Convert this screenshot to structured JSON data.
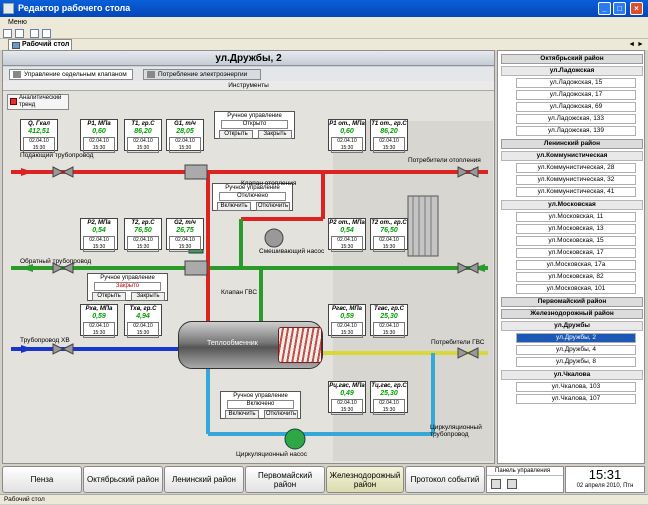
{
  "window": {
    "title": "Редактор рабочего стола",
    "min": "_",
    "max": "□",
    "close": "×"
  },
  "menu": {
    "item": "Меню"
  },
  "tabs": {
    "main": "Рабочий стол",
    "nav": "◄ ►"
  },
  "address": "ул.Дружбы, 2",
  "subtabs": [
    "Управление седельным клапаном",
    "Потребление электроэнергии"
  ],
  "instruments": "Инструменты",
  "trend": "Аналитический тренд",
  "gauges": [
    {
      "label": "Q, Гкал",
      "value": "412,51",
      "date": "02.04.10 15:30"
    },
    {
      "label": "P1, МПа",
      "value": "0,60",
      "date": "02.04.10 15:30"
    },
    {
      "label": "T1, гр.С",
      "value": "86,20",
      "date": "02.04.10 15:30"
    },
    {
      "label": "G1, т/ч",
      "value": "28,05",
      "date": "02.04.10 15:30"
    },
    {
      "label": "P1 от., МПа",
      "value": "0,60",
      "date": "02.04.10 15:30"
    },
    {
      "label": "T1 от., гр.С",
      "value": "86,20",
      "date": "02.04.10 15:30"
    },
    {
      "label": "P2, МПа",
      "value": "0,54",
      "date": "02.04.10 15:30"
    },
    {
      "label": "T2, гр.С",
      "value": "76,50",
      "date": "02.04.10 15:30"
    },
    {
      "label": "G2, т/ч",
      "value": "26,75",
      "date": "02.04.10 15:30"
    },
    {
      "label": "P2 от., МПа",
      "value": "0,54",
      "date": "02.04.10 15:30"
    },
    {
      "label": "T2 от., гр.С",
      "value": "76,50",
      "date": "02.04.10 15:30"
    },
    {
      "label": "Pхв, МПа",
      "value": "0,59",
      "date": "02.04.10 15:30"
    },
    {
      "label": "Tхв, гр.С",
      "value": "4,94",
      "date": "02.04.10 15:30"
    },
    {
      "label": "Pгвс, МПа",
      "value": "0,59",
      "date": "02.04.10 15:30"
    },
    {
      "label": "Tгвс, гр.С",
      "value": "25,30",
      "date": "02.04.10 15:30"
    },
    {
      "label": "Pц.гвс, МПа",
      "value": "0,49",
      "date": "02.04.10 15:30"
    },
    {
      "label": "Tц.гвс, гр.С",
      "value": "25,30",
      "date": "02.04.10 15:30"
    }
  ],
  "controls": [
    {
      "title": "Ручное управление",
      "status": "Открыто",
      "b1": "Открыть",
      "b2": "Закрыть"
    },
    {
      "title": "Ручное управление",
      "status": "Отключено",
      "b1": "Включить",
      "b2": "Отключить"
    },
    {
      "title": "Ручное управление",
      "status": "Закрыто",
      "b1": "Открыть",
      "b2": "Закрыть"
    },
    {
      "title": "Ручное управление",
      "status": "Включено",
      "b1": "Включить",
      "b2": "Отключить"
    }
  ],
  "labels": {
    "supply": "Подающий трубопровод",
    "return": "Обратный трубопровод",
    "cold": "Трубопровод ХВ",
    "heatcons": "Потребители отопления",
    "valve": "Клапан отопления",
    "mixpump": "Смешивающий насос",
    "gvsvalve": "Клапан ГВС",
    "exchanger": "Теплообменник",
    "gvscons": "Потребители ГВС",
    "circpipe": "Циркуляционный трубопровод",
    "circpump": "Циркуляционный насос"
  },
  "districts": [
    {
      "name": "Октябрьский район",
      "streets": [
        {
          "name": "ул.Ладожская",
          "items": [
            "ул.Ладожская, 15",
            "ул.Ладожская, 17",
            "ул.Ладожская, 69",
            "ул.Ладожская, 133",
            "ул.Ладожская, 139"
          ]
        }
      ]
    },
    {
      "name": "Ленинский район",
      "streets": [
        {
          "name": "ул.Коммунистическая",
          "items": [
            "ул.Коммунистическая, 28",
            "ул.Коммунистическая, 32",
            "ул.Коммунистическая, 41"
          ]
        },
        {
          "name": "ул.Московская",
          "items": [
            "ул.Московская, 11",
            "ул.Московская, 13",
            "ул.Московская, 15",
            "ул.Московская, 17",
            "ул.Московская, 17а",
            "ул.Московская, 82",
            "ул.Московская, 101"
          ]
        }
      ]
    },
    {
      "name": "Первомайский район",
      "streets": []
    },
    {
      "name": "Железнодорожный район",
      "streets": [
        {
          "name": "ул.Дружбы",
          "items": [
            "ул.Дружбы, 2",
            "ул.Дружбы, 4",
            "ул.Дружбы, 8"
          ]
        },
        {
          "name": "ул.Чкалова",
          "items": [
            "ул.Чкалова, 103",
            "ул.Чкалова, 107"
          ]
        }
      ]
    }
  ],
  "selected": "ул.Дружбы, 2",
  "bottom": {
    "buttons": [
      "Пенза",
      "Октябрьский район",
      "Ленинский район",
      "Первомайский район",
      "Железнодорожный район",
      "Протокол событий"
    ],
    "active": 4,
    "control_panel": "Панель управления",
    "time": "15:31",
    "date": "02 апреля 2010, Птн"
  },
  "status": "Рабочий стол"
}
